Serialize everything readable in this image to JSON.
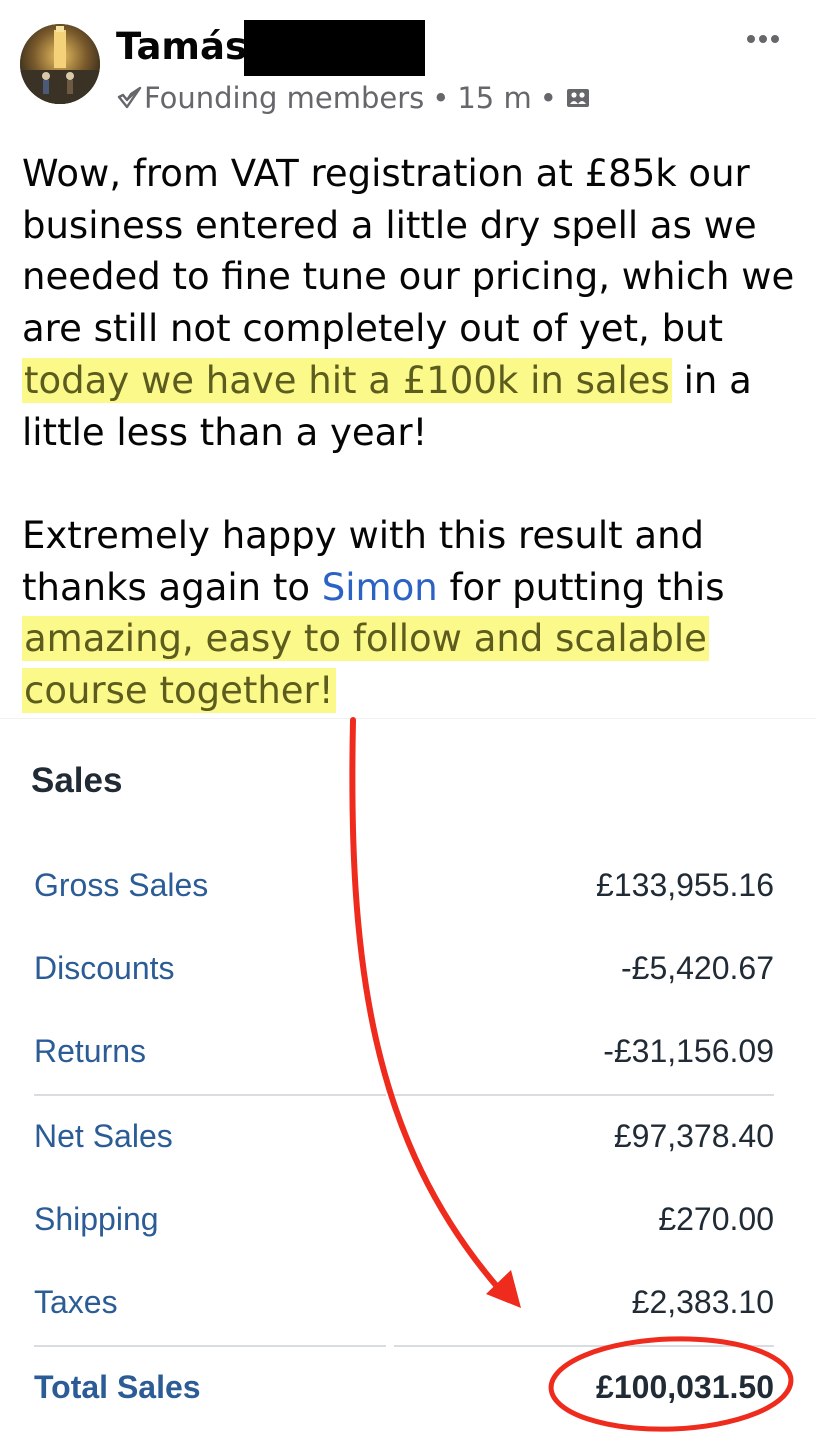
{
  "post": {
    "author_name": "Tamás",
    "group_badge": "Founding members",
    "time": "15 m",
    "paragraphs": [
      {
        "segments": [
          {
            "text": "Wow, from VAT registration at £85k our business entered a little dry spell as we needed to fine tune our pricing, which we are still not completely out of yet, but ",
            "style": "plain"
          },
          {
            "text": "today we have hit a £100k in sales",
            "style": "highlight"
          },
          {
            "text": " in a little less than a year!",
            "style": "plain"
          }
        ]
      },
      {
        "segments": [
          {
            "text": "Extremely happy with this result and thanks again to ",
            "style": "plain"
          },
          {
            "text": "Simon",
            "style": "mention"
          },
          {
            "text": " for putting this ",
            "style": "plain"
          },
          {
            "text": "amazing, easy to follow and scalable course together!",
            "style": "highlight"
          }
        ]
      }
    ]
  },
  "sales": {
    "title": "Sales",
    "rows": [
      {
        "label": "Gross Sales",
        "value": "£133,955.16"
      },
      {
        "label": "Discounts",
        "value": "-£5,420.67"
      },
      {
        "label": "Returns",
        "value": "-£31,156.09"
      },
      {
        "label": "Net Sales",
        "value": "£97,378.40"
      },
      {
        "label": "Shipping",
        "value": "£270.00"
      },
      {
        "label": "Taxes",
        "value": "£2,383.10"
      },
      {
        "label": "Total Sales",
        "value": "£100,031.50"
      }
    ]
  },
  "icons": {
    "more": "more-options-icon",
    "group_badge": "group-member-icon",
    "audience": "group-audience-icon"
  },
  "colors": {
    "highlight": "#fbf98a",
    "mention": "#2b62c4",
    "sales_label": "#2b5c96",
    "annotation": "#ee2b1d"
  }
}
